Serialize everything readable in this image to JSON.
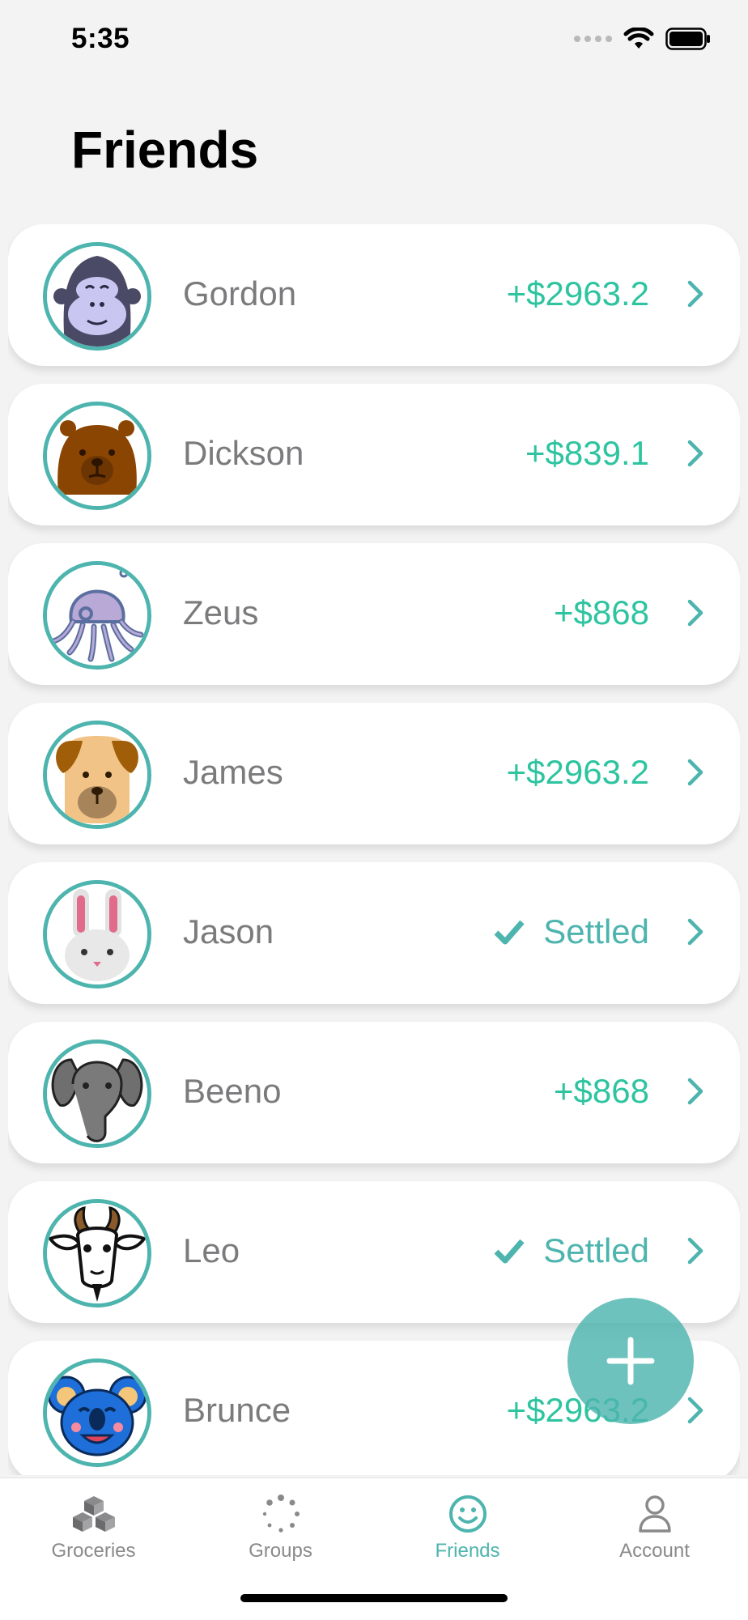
{
  "status_bar": {
    "time": "5:35"
  },
  "page": {
    "title": "Friends"
  },
  "colors": {
    "accent": "#4db4ae",
    "positive": "#2ec4a0",
    "name_text": "#7b7b7d"
  },
  "friends": [
    {
      "name": "Gordon",
      "avatar": "gorilla-icon",
      "status": "balance",
      "balance": "+$2963.2"
    },
    {
      "name": "Dickson",
      "avatar": "bear-icon",
      "status": "balance",
      "balance": "+$839.1"
    },
    {
      "name": "Zeus",
      "avatar": "octopus-icon",
      "status": "balance",
      "balance": "+$868"
    },
    {
      "name": "James",
      "avatar": "dog-icon",
      "status": "balance",
      "balance": "+$2963.2"
    },
    {
      "name": "Jason",
      "avatar": "rabbit-icon",
      "status": "settled",
      "balance": "Settled"
    },
    {
      "name": "Beeno",
      "avatar": "elephant-icon",
      "status": "balance",
      "balance": "+$868"
    },
    {
      "name": "Leo",
      "avatar": "goat-icon",
      "status": "settled",
      "balance": "Settled"
    },
    {
      "name": "Brunce",
      "avatar": "koala-icon",
      "status": "balance",
      "balance": "+$2963.2"
    }
  ],
  "fab": {
    "icon": "plus-icon"
  },
  "tabs": [
    {
      "label": "Groceries",
      "icon": "cubes-icon",
      "active": false
    },
    {
      "label": "Groups",
      "icon": "dotted-circle-icon",
      "active": false
    },
    {
      "label": "Friends",
      "icon": "smiley-icon",
      "active": true
    },
    {
      "label": "Account",
      "icon": "person-icon",
      "active": false
    }
  ]
}
